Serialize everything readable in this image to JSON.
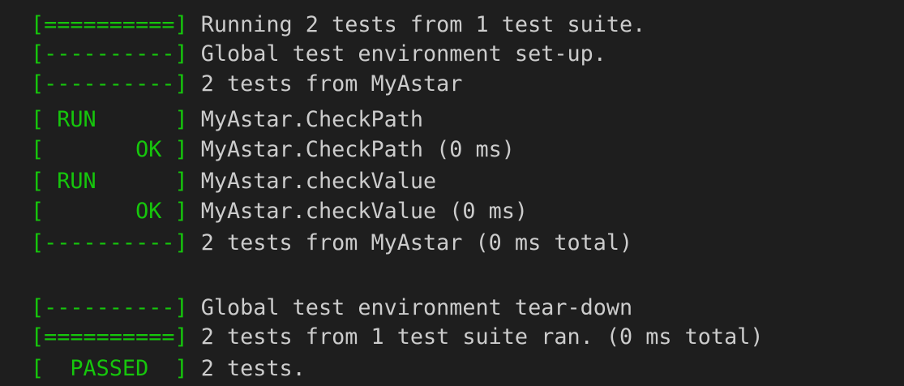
{
  "colors": {
    "background": "#1e1e1e",
    "tag": "#16c60c",
    "text": "#cccccc"
  },
  "terminal": {
    "lines": [
      {
        "tag": "[==========]",
        "text": " Running 2 tests from 1 test suite."
      },
      {
        "tag": "[----------]",
        "text": " Global test environment set-up."
      },
      {
        "tag": "[----------]",
        "text": " 2 tests from MyAstar"
      },
      {
        "tag": "[ RUN      ]",
        "text": " MyAstar.CheckPath"
      },
      {
        "tag": "[       OK ]",
        "text": " MyAstar.CheckPath (0 ms)"
      },
      {
        "tag": "[ RUN      ]",
        "text": " MyAstar.checkValue"
      },
      {
        "tag": "[       OK ]",
        "text": " MyAstar.checkValue (0 ms)"
      },
      {
        "tag": "[----------]",
        "text": " 2 tests from MyAstar (0 ms total)"
      },
      {
        "tag": "[----------]",
        "text": " Global test environment tear-down"
      },
      {
        "tag": "[==========]",
        "text": " 2 tests from 1 test suite ran. (0 ms total)"
      },
      {
        "tag": "[  PASSED  ]",
        "text": " 2 tests."
      }
    ]
  }
}
